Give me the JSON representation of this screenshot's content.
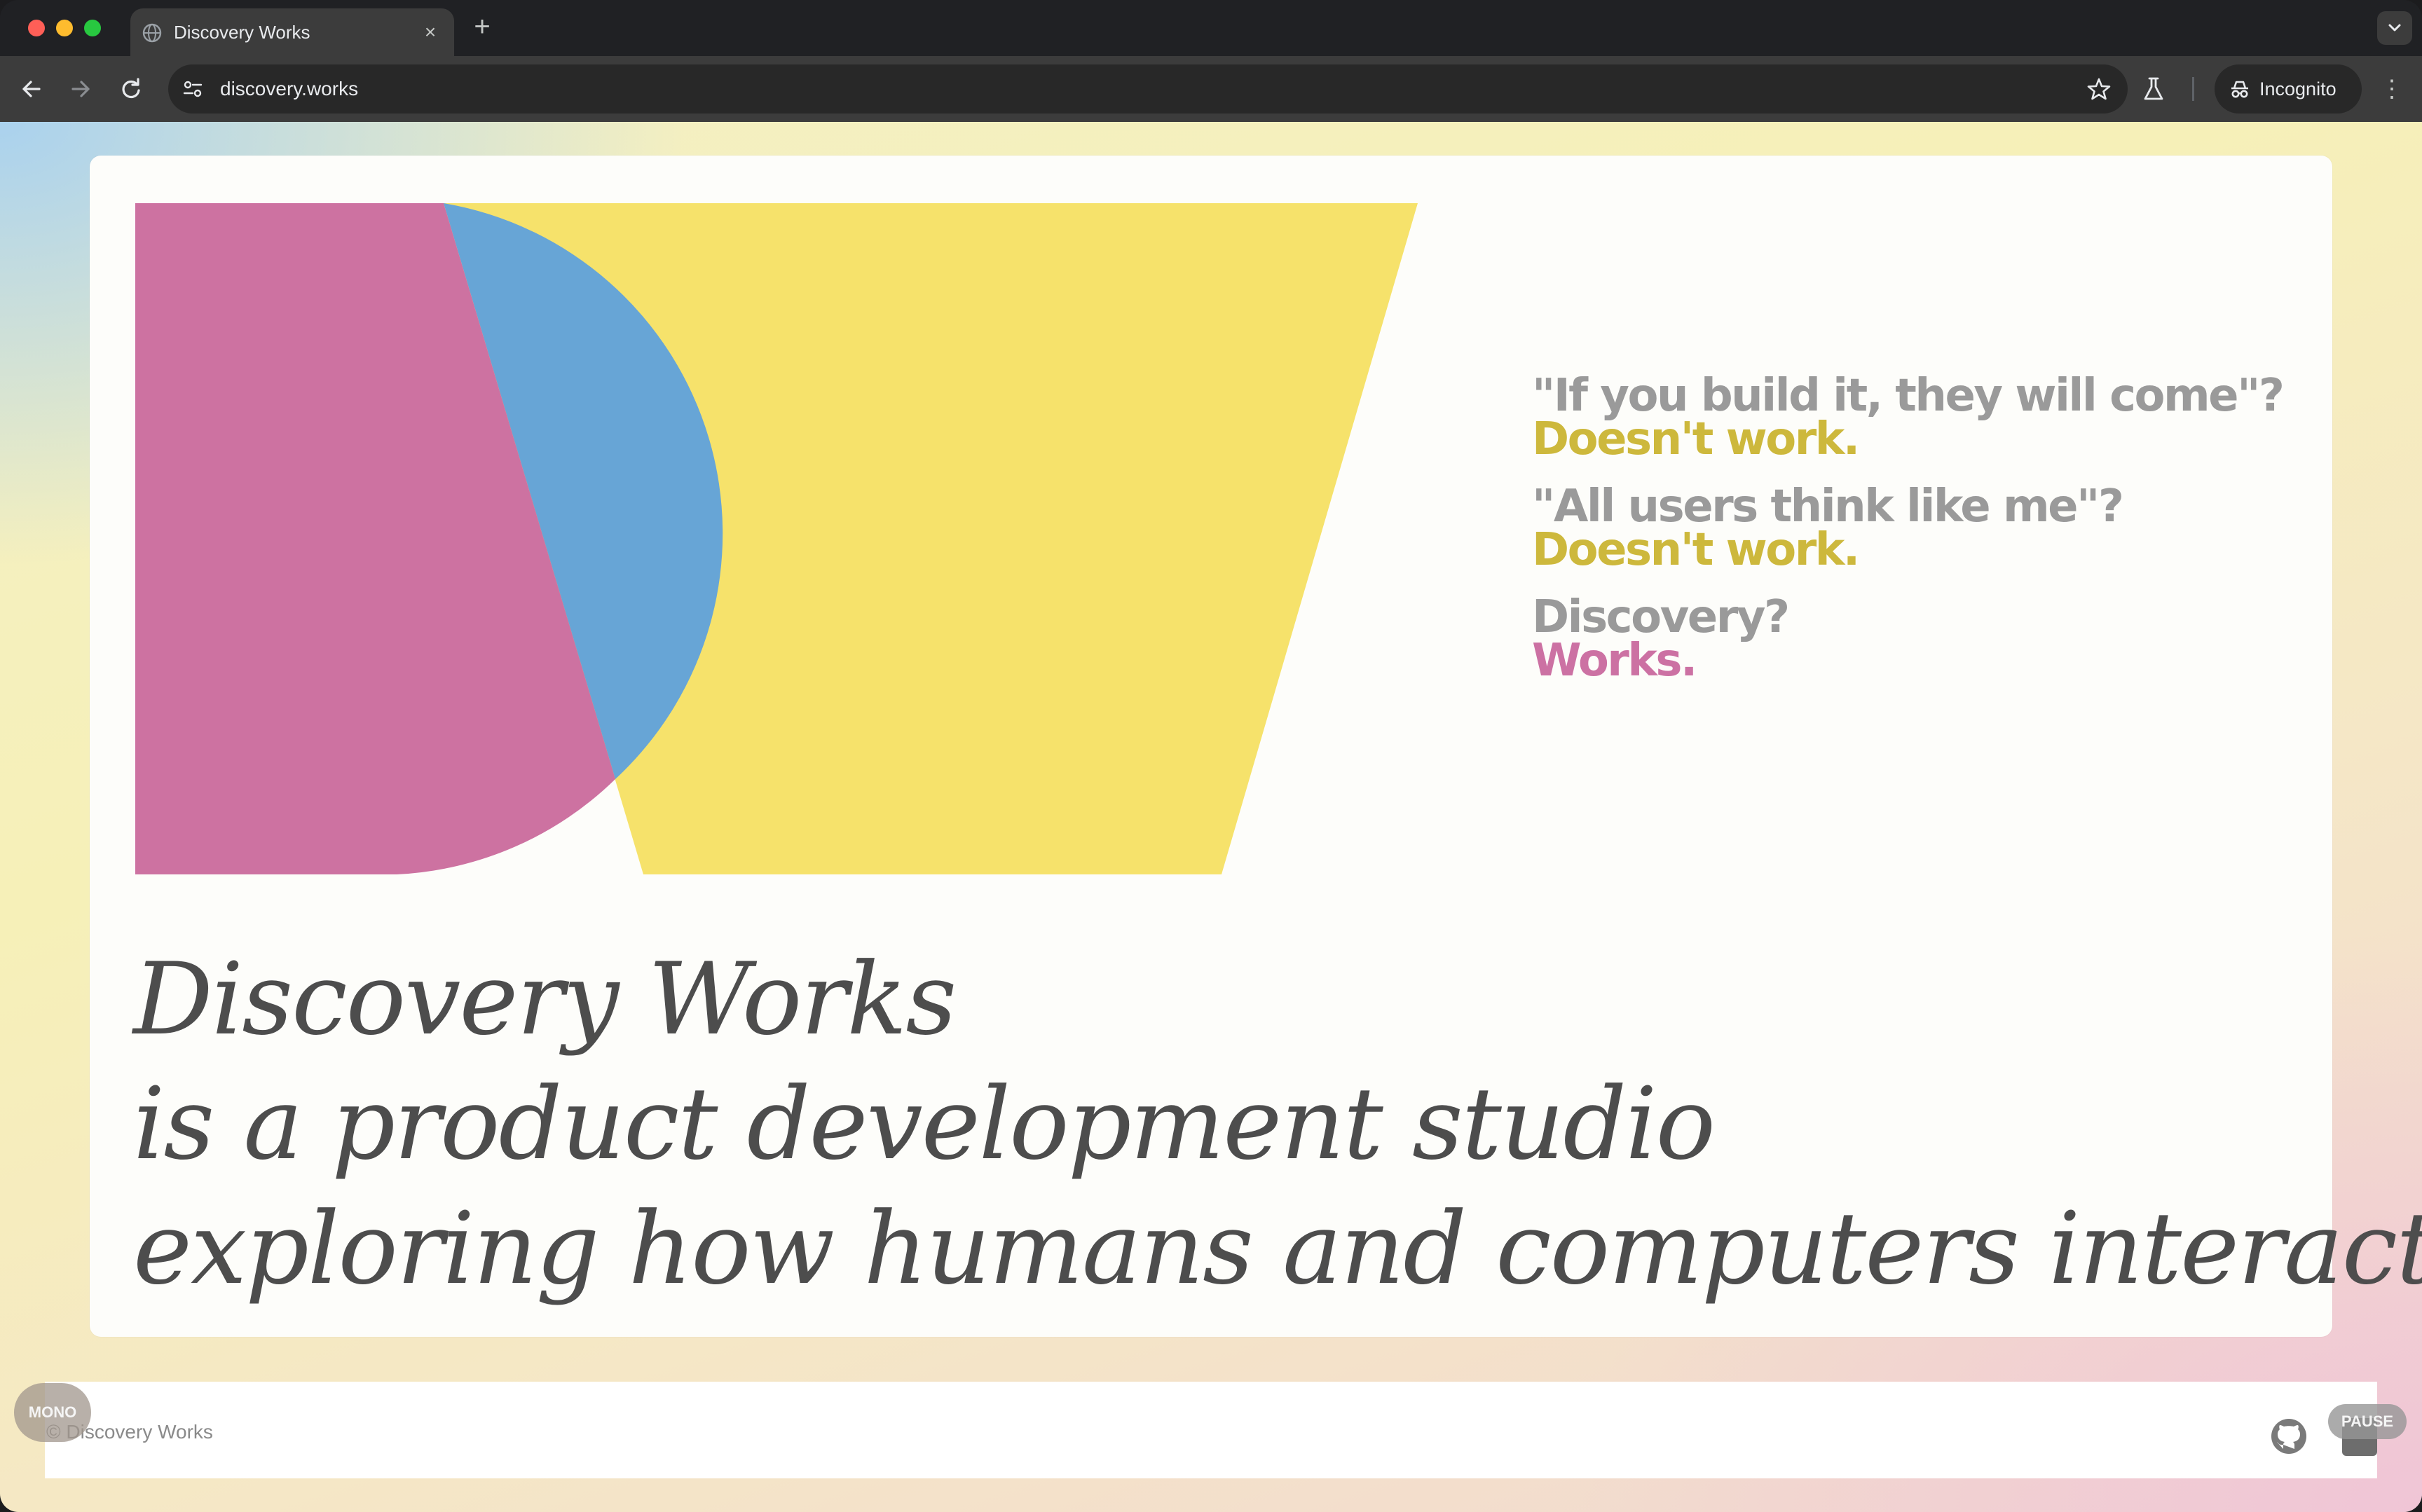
{
  "browser": {
    "tab_title": "Discovery Works",
    "tab_close_glyph": "×",
    "new_tab_glyph": "+",
    "url": "discovery.works",
    "incognito_label": "Incognito",
    "menu_glyph": "⋮",
    "icons": [
      "back-arrow-icon",
      "forward-arrow-icon",
      "reload-icon",
      "site-settings-icon",
      "bookmark-star-icon",
      "labs-flask-icon",
      "incognito-icon",
      "tab-search-chevron-icon"
    ]
  },
  "page": {
    "taglines": [
      {
        "question": "\"If you build it, they will come\"?",
        "answer": "Doesn't work.",
        "answer_color": "#cdb83c"
      },
      {
        "question": "\"All users think like me\"?",
        "answer": "Doesn't work.",
        "answer_color": "#cdb83c"
      },
      {
        "question": "Discovery?",
        "answer": "Works.",
        "answer_color": "#cc71a3"
      }
    ],
    "statement": {
      "line1": "Discovery Works",
      "line2": "is a product development studio",
      "line3": "exploring how humans and computers interact."
    },
    "logo_colors": {
      "pink": "#cd72a1",
      "blue": "#67a5d6",
      "yellow": "#f6e26b"
    }
  },
  "footer": {
    "copyright": "© Discovery Works",
    "mono_toggle": "MONO",
    "pause_button": "PAUSE",
    "icons": [
      "github-icon"
    ]
  }
}
